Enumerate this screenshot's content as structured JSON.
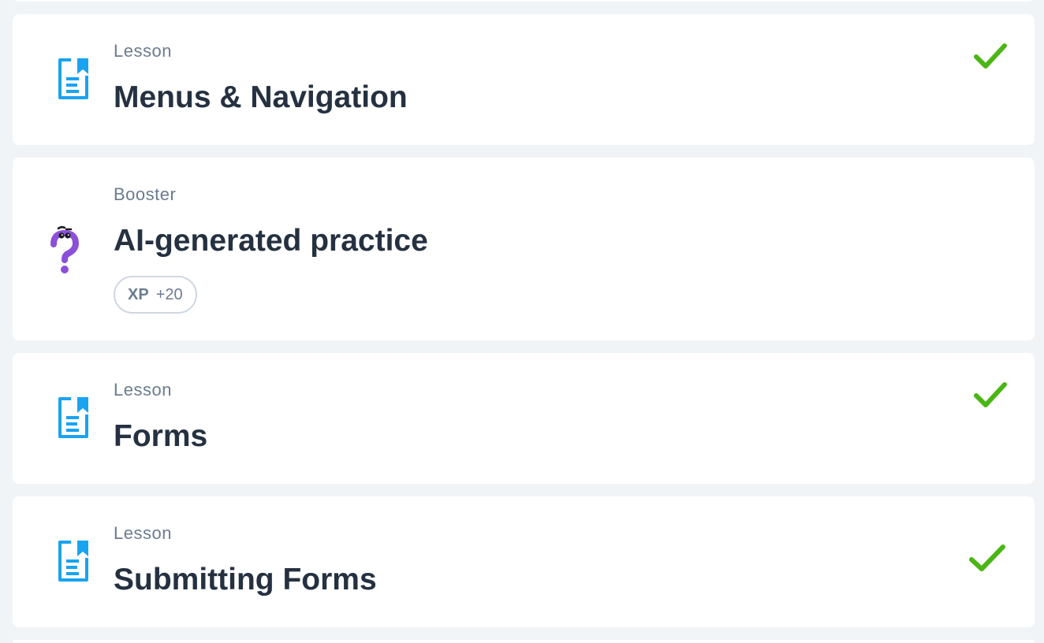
{
  "items": [
    {
      "type": "Lesson",
      "title": "Menus & Navigation",
      "icon": "lesson-document-icon",
      "completed": true
    },
    {
      "type": "Booster",
      "title": "AI-generated practice",
      "icon": "question-mark-character-icon",
      "completed": false,
      "xp": {
        "label": "XP",
        "value": "+20"
      }
    },
    {
      "type": "Lesson",
      "title": "Forms",
      "icon": "lesson-document-icon",
      "completed": true
    },
    {
      "type": "Lesson",
      "title": "Submitting Forms",
      "icon": "lesson-document-icon",
      "completed": true
    }
  ],
  "colors": {
    "page_background": "#f0f4f7",
    "card_background": "#ffffff",
    "lesson_icon": "#1aa3f0",
    "booster_icon": "#8b50d8",
    "check": "#4bb515",
    "title_text": "#253141",
    "secondary_text": "#6b7c8f"
  }
}
